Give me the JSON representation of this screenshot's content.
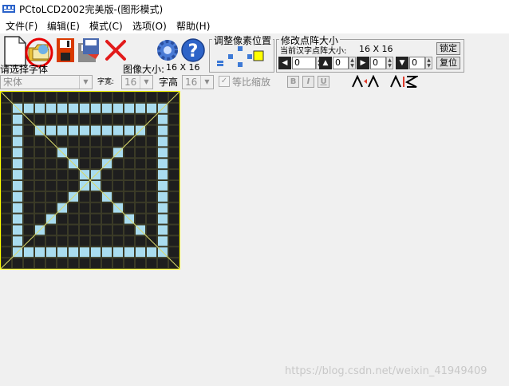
{
  "window": {
    "title": "PCtoLCD2002完美版-(图形模式)"
  },
  "menu": [
    "文件(F)",
    "编辑(E)",
    "模式(C)",
    "选项(O)",
    "帮助(H)"
  ],
  "toolbar": {
    "adjust_label": "调整像素位置",
    "resize_label": "修改点阵大小",
    "current_size_label": "当前汉字点阵大小:",
    "current_size_value": "16  X  16",
    "lock_button": "锁定",
    "restore_button": "复位",
    "spin_values": [
      "0",
      "0",
      "0",
      "0"
    ]
  },
  "font_row": {
    "select_font_label": "请选择字体",
    "font_value": "宋体",
    "image_size_label": "图像大小:",
    "image_size_value": "16  X  16",
    "char_width_label": "字宽:",
    "char_width_value": "16",
    "char_height_label": "字高",
    "char_height_value": "16",
    "scale_label": "等比缩放",
    "bold": "B",
    "italic": "I",
    "underline": "U"
  },
  "grid": {
    "size": 16,
    "on_color": "#a9dcef",
    "off_color": "#1e1e1e",
    "bg_color": "#3b3b27",
    "rows": [
      "0000000000000000",
      "0111111111111110",
      "0100000000000010",
      "0101111111111010",
      "0100000000000010",
      "0100010000100010",
      "0100001001000010",
      "0100000110000010",
      "0100000110000010",
      "0100001001000010",
      "0100010000100010",
      "0100100000010010",
      "0101000000001010",
      "0100000000000010",
      "0111111111111110",
      "0000000000000000"
    ]
  },
  "watermark": "https://blog.csdn.net/weixin_41949409"
}
